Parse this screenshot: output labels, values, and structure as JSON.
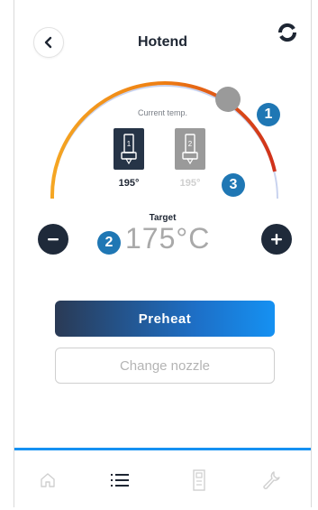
{
  "header": {
    "title": "Hotend"
  },
  "gauge": {
    "current_label": "Current temp.",
    "level_fraction": 0.78
  },
  "nozzles": [
    {
      "number": "1",
      "temp": "195°",
      "active": true
    },
    {
      "number": "2",
      "temp": "195°",
      "active": false
    }
  ],
  "target": {
    "label": "Target",
    "value": "175°C"
  },
  "badges": {
    "one": "1",
    "two": "2",
    "three": "3"
  },
  "actions": {
    "preheat_label": "Preheat",
    "change_nozzle_label": "Change nozzle"
  },
  "bottom_nav": {
    "items": [
      "home-icon",
      "list-icon",
      "file-icon",
      "wrench-icon"
    ],
    "active_index": 1
  },
  "colors": {
    "accent": "#1591f2",
    "dark": "#1f2a3a",
    "badge": "#1f77b4",
    "arc_start": "#f5a623",
    "arc_end": "#d0311b",
    "arc_rest": "#c9d3ef"
  }
}
